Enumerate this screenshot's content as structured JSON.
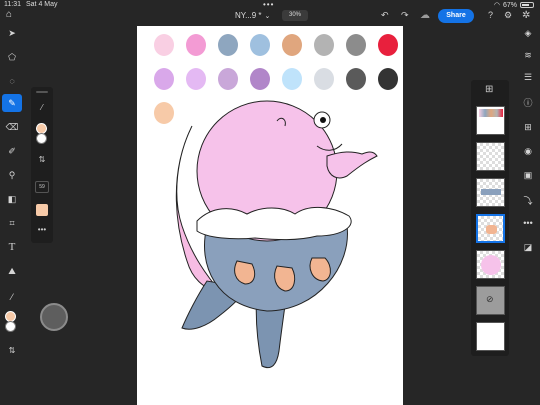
{
  "status_bar": {
    "time": "11:31",
    "date": "Sat 4 May",
    "battery": "67%",
    "battery_level": 0.67
  },
  "top_bar": {
    "document_name": "NY...9 *",
    "zoom": "30%",
    "share_label": "Share"
  },
  "brush_panel": {
    "size_value": "59"
  },
  "colors": {
    "foreground": "#f7caa8",
    "background": "#ffffff",
    "accent": "#1473e6",
    "palette": [
      "#f9cfe3",
      "#f39bd4",
      "#8ea6bf",
      "#9fc0df",
      "#e0a67e",
      "#b3b3b3",
      "#8c8c8c",
      "#e8203d",
      "#d9a8ea",
      "#e4b9f3",
      "#c9a7d9",
      "#b186c9",
      "#bfe3fb",
      "#d9dde3",
      "#5a5a5a",
      "#333333",
      "#f7caa8"
    ]
  },
  "icons": {
    "left_tools": [
      "select-arrow-icon",
      "transform-icon",
      "lasso-icon",
      "brush-icon",
      "eraser-icon",
      "smudge-icon",
      "fill-icon",
      "paint-bucket-icon",
      "crop-icon",
      "text-icon",
      "image-place-icon",
      "eyedropper-icon",
      "swap-colors-icon"
    ],
    "right_tools": [
      "layers-icon",
      "layer-properties-icon",
      "adjustments-icon",
      "info-icon",
      "add-layer-icon",
      "visibility-icon",
      "mask-icon",
      "clip-icon",
      "more-icon",
      "fill-tool-icon"
    ]
  }
}
